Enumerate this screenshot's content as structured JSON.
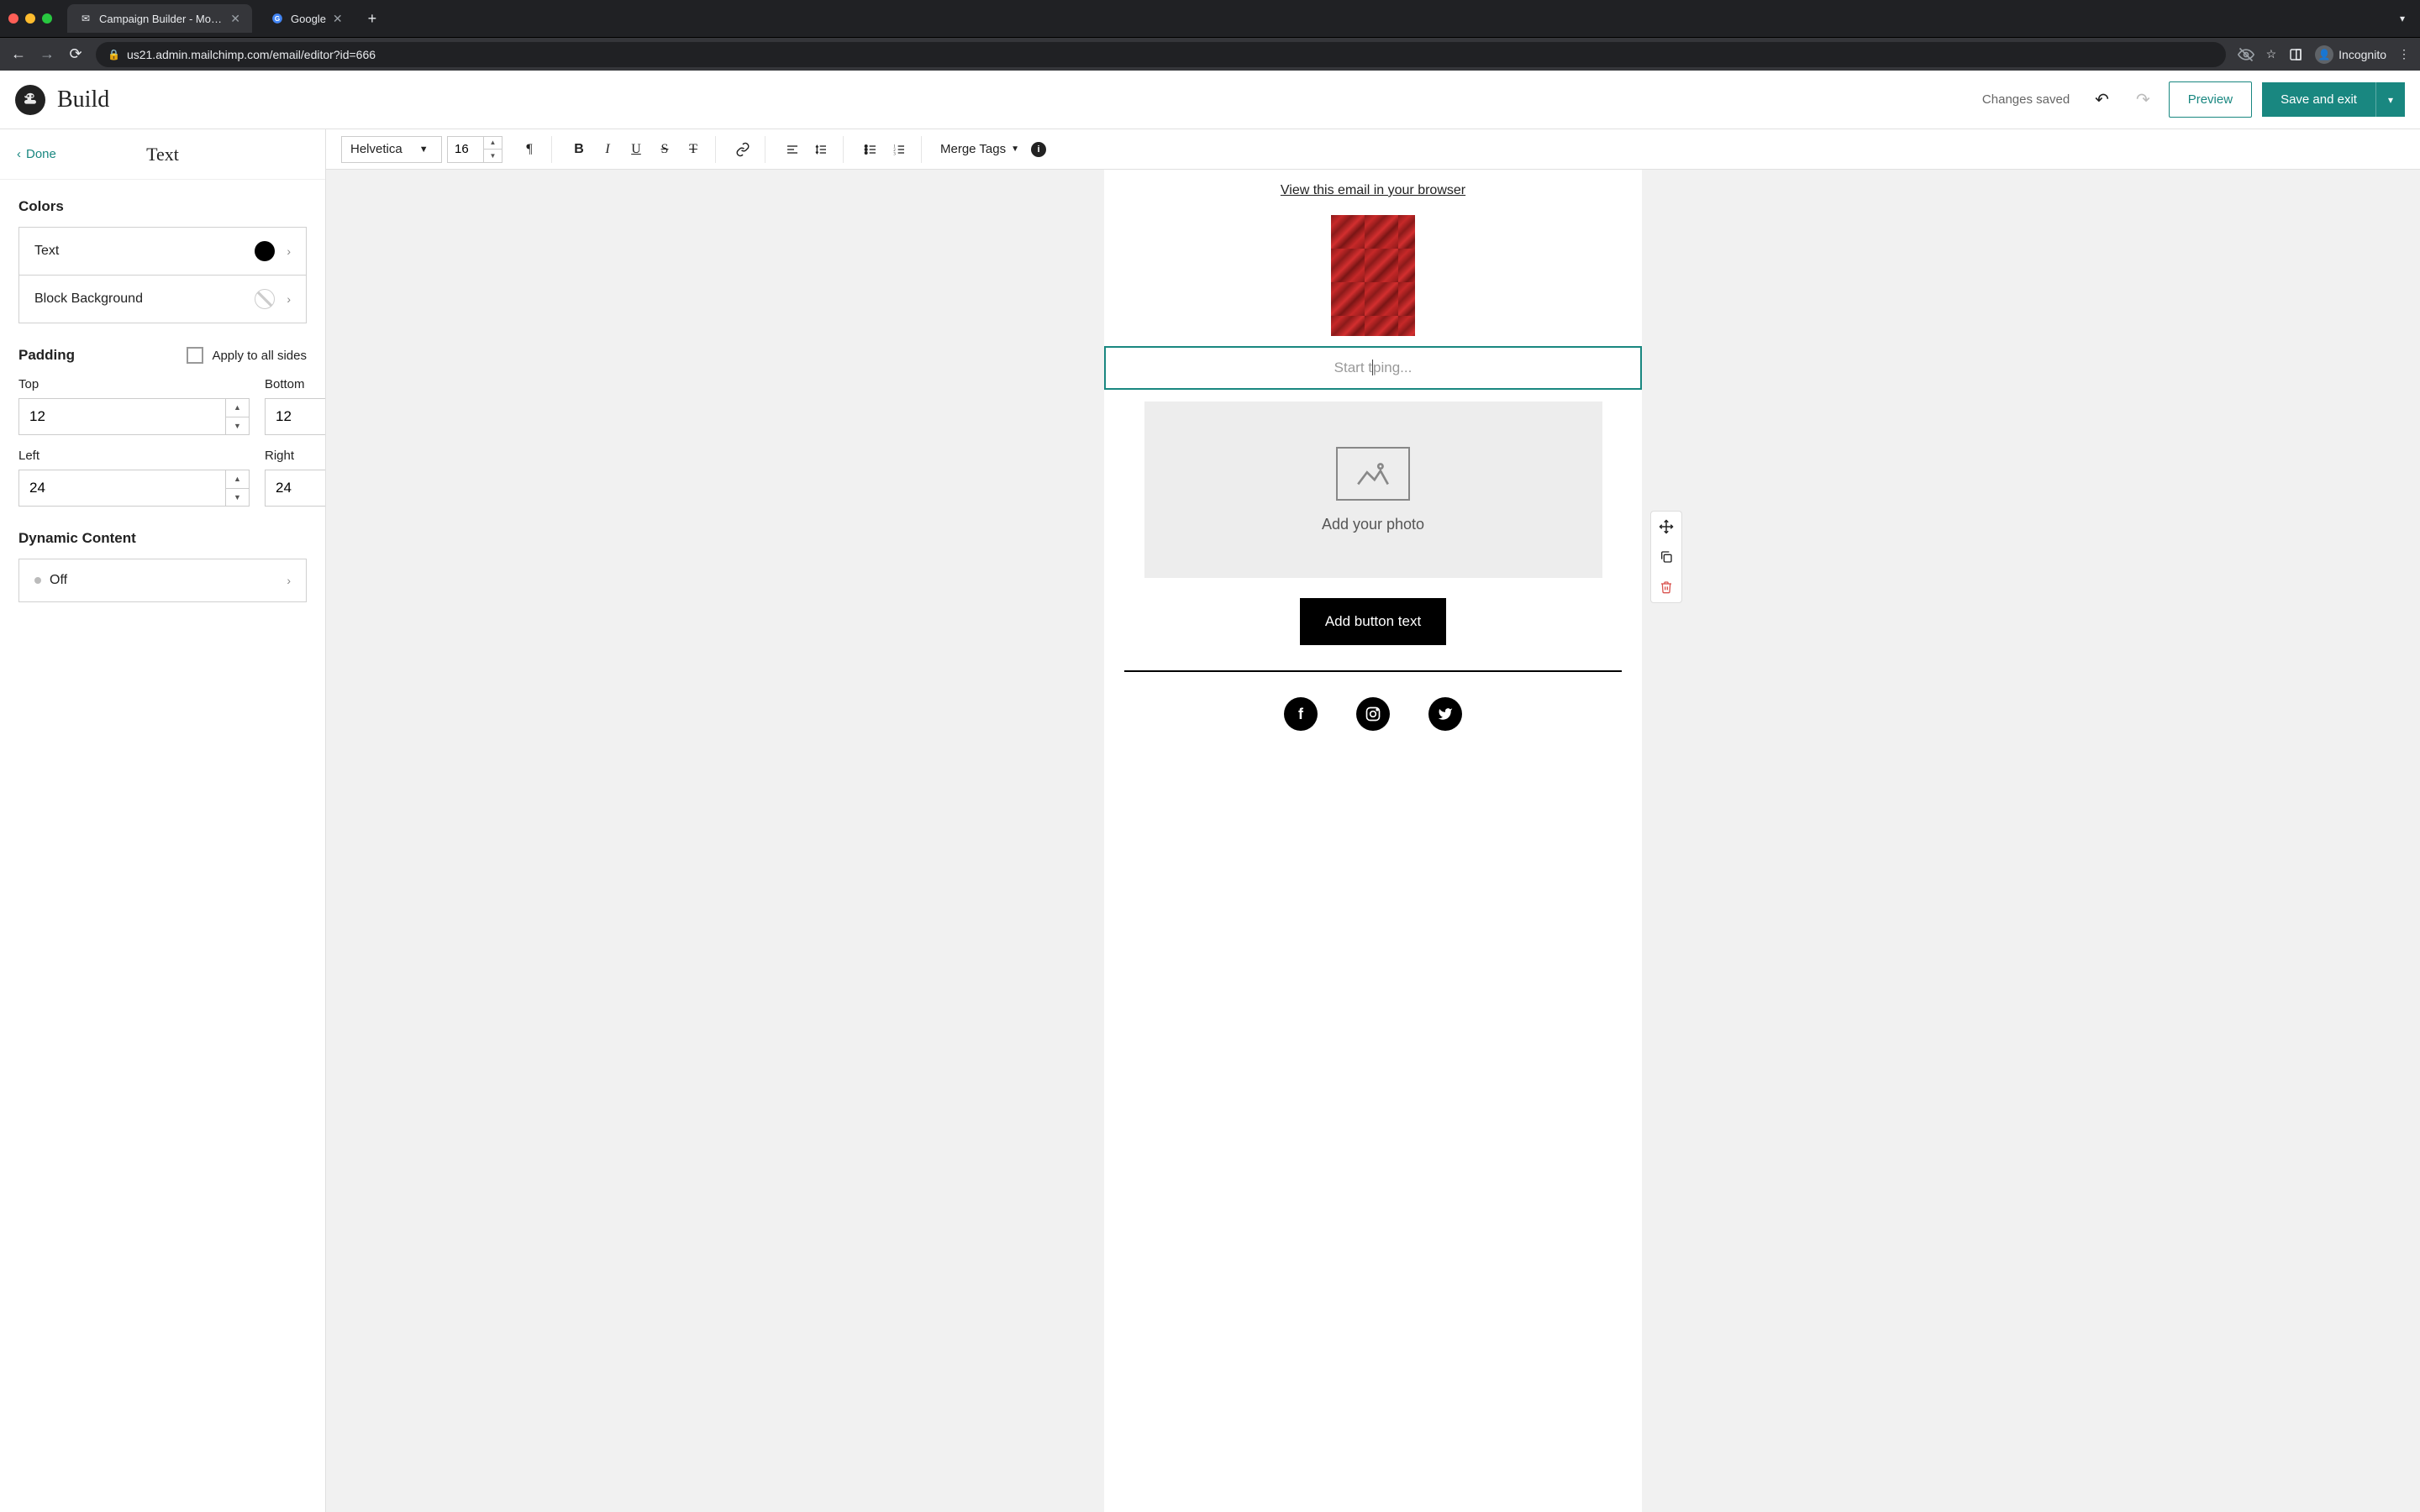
{
  "browser": {
    "tabs": [
      {
        "title": "Campaign Builder - Mood Joy |",
        "active": true
      },
      {
        "title": "Google",
        "active": false
      }
    ],
    "url": "us21.admin.mailchimp.com/email/editor?id=666",
    "incognito_label": "Incognito"
  },
  "header": {
    "title": "Build",
    "status": "Changes saved",
    "preview": "Preview",
    "save": "Save and exit"
  },
  "sidebar": {
    "done": "Done",
    "title": "Text",
    "colors_label": "Colors",
    "color_rows": {
      "text": "Text",
      "block_bg": "Block Background"
    },
    "padding_label": "Padding",
    "apply_all": "Apply to all sides",
    "fields": {
      "top": {
        "label": "Top",
        "value": "12"
      },
      "bottom": {
        "label": "Bottom",
        "value": "12"
      },
      "left": {
        "label": "Left",
        "value": "24"
      },
      "right": {
        "label": "Right",
        "value": "24"
      }
    },
    "dynamic_label": "Dynamic Content",
    "dynamic_value": "Off"
  },
  "toolbar": {
    "font": "Helvetica",
    "size": "16",
    "merge_tags": "Merge Tags"
  },
  "canvas": {
    "view_browser": "View this email in your browser",
    "text_placeholder_pre": "Start t",
    "text_placeholder_post": "ping...",
    "add_photo": "Add your photo",
    "button_text": "Add button text"
  }
}
